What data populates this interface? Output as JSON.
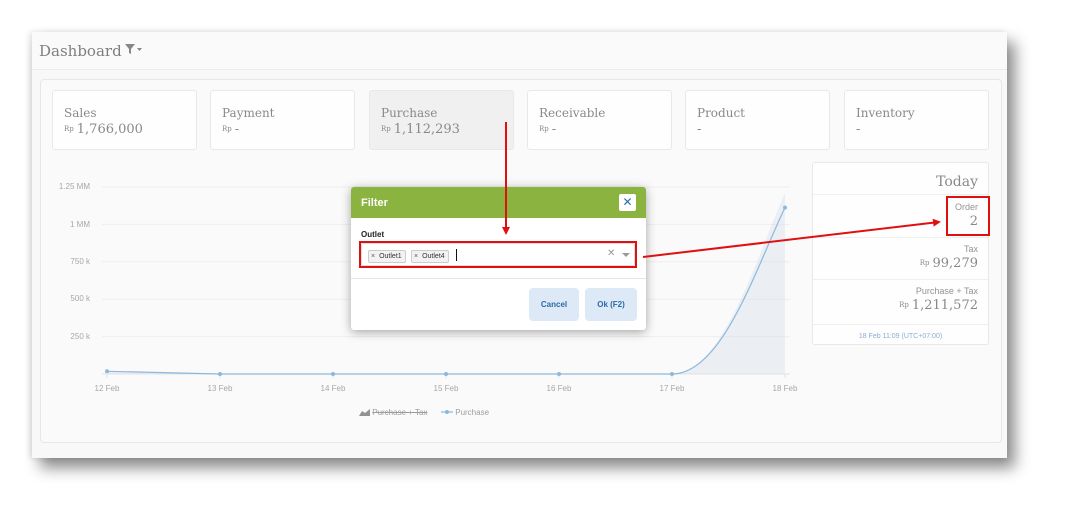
{
  "header": {
    "title": "Dashboard",
    "filter_icon": "filter-dropdown-icon"
  },
  "summary_cards": [
    {
      "label": "Sales",
      "currency": "Rp",
      "value": "1,766,000",
      "active": false
    },
    {
      "label": "Payment",
      "currency": "Rp",
      "value": "-",
      "active": false
    },
    {
      "label": "Purchase",
      "currency": "Rp",
      "value": "1,112,293",
      "active": true
    },
    {
      "label": "Receivable",
      "currency": "Rp",
      "value": "-",
      "active": false
    },
    {
      "label": "Product",
      "currency": "",
      "value": "-",
      "active": false
    },
    {
      "label": "Inventory",
      "currency": "",
      "value": "-",
      "active": false
    }
  ],
  "today": {
    "title": "Today",
    "order_label": "Order",
    "order_value": "2",
    "tax_label": "Tax",
    "tax_currency": "Rp",
    "tax_value": "99,279",
    "pt_label": "Purchase + Tax",
    "pt_currency": "Rp",
    "pt_value": "1,211,572",
    "timestamp": "18 Feb 11:09 (UTC+07:00)"
  },
  "chart_data": {
    "type": "area",
    "categories": [
      "12 Feb",
      "13 Feb",
      "14 Feb",
      "15 Feb",
      "16 Feb",
      "17 Feb",
      "18 Feb"
    ],
    "yticks": [
      "250 k",
      "500 k",
      "750 k",
      "1 MM",
      "1.25 MM"
    ],
    "ylim": [
      0,
      1250000
    ],
    "series": [
      {
        "name": "Purchase + Tax",
        "values": [
          18000,
          0,
          0,
          0,
          0,
          0,
          1211572
        ],
        "hidden": true,
        "color": "#a9bfd6"
      },
      {
        "name": "Purchase",
        "values": [
          18000,
          0,
          0,
          0,
          0,
          0,
          1112293
        ],
        "hidden": false,
        "color": "#3b84c4"
      }
    ],
    "legend_position": "bottom"
  },
  "filter_dialog": {
    "title": "Filter",
    "close_label": "✕",
    "outlet_label": "Outlet",
    "chips": [
      "Outlet1",
      "Outlet4"
    ],
    "chip_remove": "×",
    "clear_label": "✕",
    "cancel_label": "Cancel",
    "ok_label": "Ok (F2)",
    "accent": "#8ab33f"
  },
  "annotation_color": "#e01010"
}
